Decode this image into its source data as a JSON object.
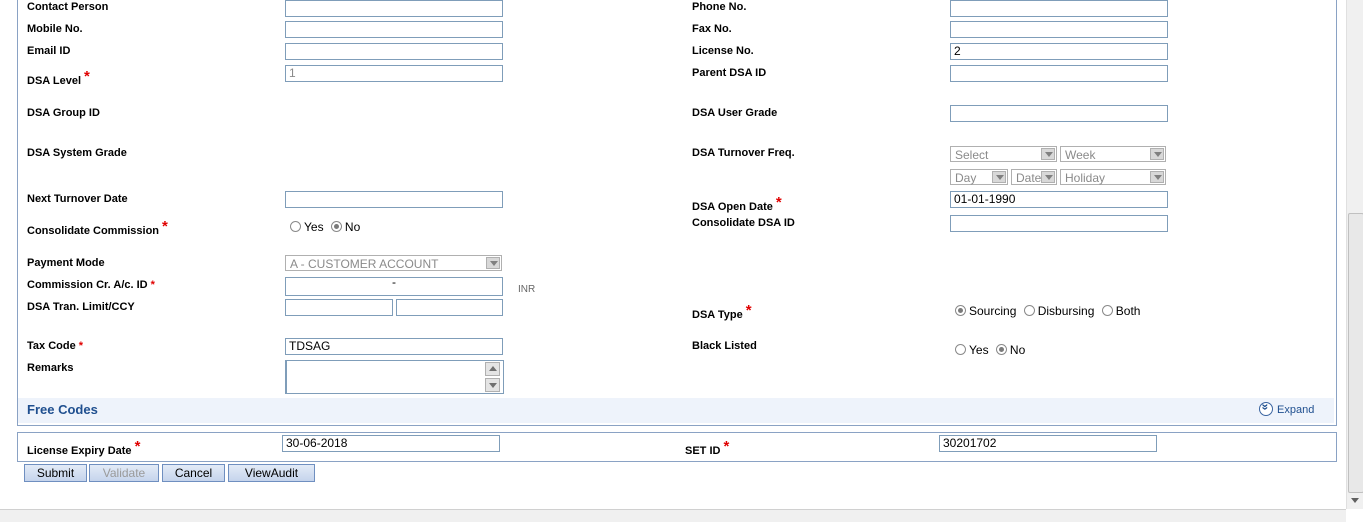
{
  "labels": {
    "contact_person": "Contact Person",
    "mobile_no": "Mobile No.",
    "email_id": "Email ID",
    "dsa_level": "DSA Level",
    "dsa_group_id": "DSA Group ID",
    "dsa_system_grade": "DSA System Grade",
    "next_turnover_date": "Next Turnover Date",
    "consolidate_commission": "Consolidate Commission",
    "payment_mode": "Payment Mode",
    "commission_cr_ac_id": "Commission Cr. A/c. ID",
    "dsa_tran_limit_ccy": "DSA Tran. Limit/CCY",
    "tax_code": "Tax Code",
    "remarks": "Remarks",
    "phone_no": "Phone No.",
    "fax_no": "Fax No.",
    "license_no": "License No.",
    "parent_dsa_id": "Parent DSA ID",
    "dsa_user_grade": "DSA User Grade",
    "dsa_turnover_freq": "DSA Turnover Freq.",
    "dsa_open_date": "DSA Open Date",
    "consolidate_dsa_id": "Consolidate DSA ID",
    "dsa_type": "DSA Type",
    "black_listed": "Black Listed",
    "license_expiry_date": "License Expiry Date",
    "set_id": "SET ID"
  },
  "required_mark": "*",
  "values": {
    "contact_person": "",
    "mobile_no": "",
    "email_id": "",
    "dsa_level": "1",
    "next_turnover_date": "",
    "commission_cr_ac_id": "-",
    "commission_currency": "INR",
    "dsa_tran_limit": "",
    "dsa_tran_ccy": "",
    "tax_code": "TDSAG",
    "remarks": "",
    "phone_no": "",
    "fax_no": "",
    "license_no": "2",
    "parent_dsa_id": "",
    "dsa_user_grade": "",
    "dsa_open_date": "01-01-1990",
    "consolidate_dsa_id": "",
    "license_expiry_date": "30-06-2018",
    "set_id": "30201702"
  },
  "selects": {
    "payment_mode": "A - CUSTOMER ACCOUNT",
    "freq_select": "Select",
    "freq_week": "Week",
    "freq_day": "Day",
    "freq_date": "Date",
    "freq_holiday": "Holiday"
  },
  "radios": {
    "yes": "Yes",
    "no": "No",
    "sourcing": "Sourcing",
    "disbursing": "Disbursing",
    "both": "Both"
  },
  "section": {
    "free_codes": "Free Codes",
    "expand": "Expand"
  },
  "buttons": {
    "submit": "Submit",
    "validate": "Validate",
    "cancel": "Cancel",
    "view_audit": "ViewAudit"
  }
}
